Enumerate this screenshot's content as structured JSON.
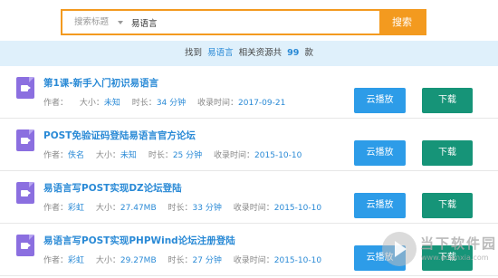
{
  "search": {
    "type_label": "搜索标题",
    "query": "易语言",
    "button_label": "搜索"
  },
  "result_summary": {
    "prefix": "找到",
    "keyword": "易语言",
    "middle": "相关资源共",
    "count": "99",
    "suffix": "款"
  },
  "labels": {
    "author": "作者：",
    "size": "大小：",
    "duration": "时长：",
    "date": "收录时间：",
    "play": "云播放",
    "download": "下载"
  },
  "items": [
    {
      "title": "第1课-新手入门初识易语言",
      "author": "",
      "size": "未知",
      "duration": "34 分钟",
      "date": "2017-09-21"
    },
    {
      "title": "POST免验证码登陆易语言官方论坛",
      "author": "佚名",
      "size": "未知",
      "duration": "25 分钟",
      "date": "2015-10-10"
    },
    {
      "title": "易语言写POST实现DZ论坛登陆",
      "author": "彩虹",
      "size": "27.47MB",
      "duration": "33 分钟",
      "date": "2015-10-10"
    },
    {
      "title": "易语言写POST实现PHPWind论坛注册登陆",
      "author": "彩虹",
      "size": "29.27MB",
      "duration": "27 分钟",
      "date": "2015-10-10"
    }
  ],
  "watermark": {
    "text": "当下软件园",
    "url": "www.downxia.com"
  }
}
